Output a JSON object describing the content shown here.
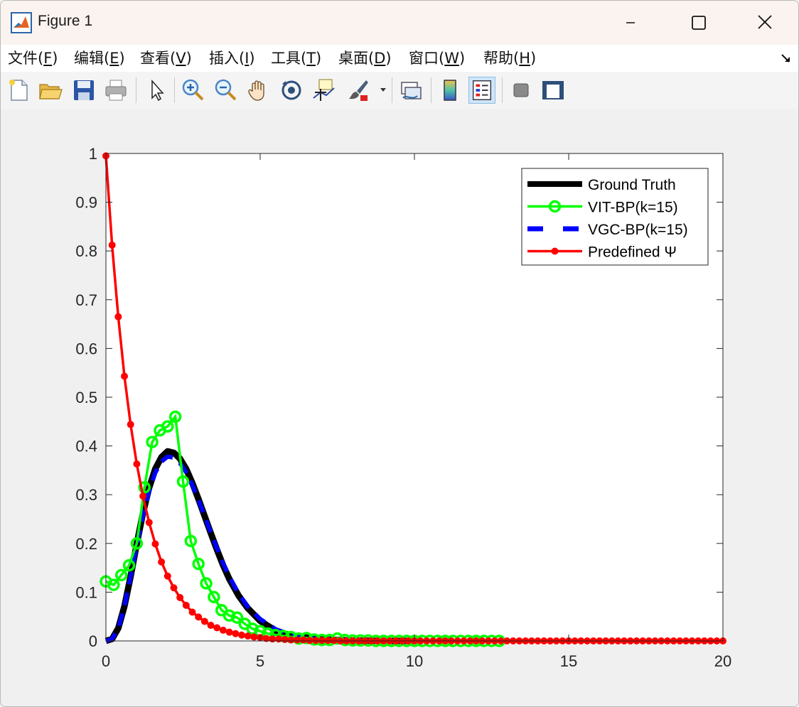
{
  "window": {
    "title": "Figure 1"
  },
  "menu": {
    "items": [
      {
        "label": "文件(",
        "key": "F",
        "tail": ")"
      },
      {
        "label": "编辑(",
        "key": "E",
        "tail": ")"
      },
      {
        "label": "查看(",
        "key": "V",
        "tail": ")"
      },
      {
        "label": "插入(",
        "key": "I",
        "tail": ")"
      },
      {
        "label": "工具(",
        "key": "T",
        "tail": ")"
      },
      {
        "label": "桌面(",
        "key": "D",
        "tail": ")"
      },
      {
        "label": "窗口(",
        "key": "W",
        "tail": ")"
      },
      {
        "label": "帮助(",
        "key": "H",
        "tail": ")"
      }
    ]
  },
  "toolbar": {
    "buttons": [
      "new-figure",
      "open-file",
      "save",
      "print",
      "edit-plot",
      "zoom-in",
      "zoom-out",
      "pan",
      "rotate-3d",
      "data-cursor",
      "brush",
      "link-plot",
      "insert-colorbar",
      "insert-legend",
      "hide-plot-tools",
      "show-plot-tools"
    ],
    "pressed": "insert-legend"
  },
  "chart_data": {
    "type": "line",
    "xlim": [
      0,
      20
    ],
    "ylim": [
      0,
      1
    ],
    "x_ticks": [
      0,
      5,
      10,
      15,
      20
    ],
    "y_ticks": [
      0,
      0.1,
      0.2,
      0.3,
      0.4,
      0.5,
      0.6,
      0.7,
      0.8,
      0.9,
      1
    ],
    "x_tick_labels": [
      "0",
      "5",
      "10",
      "15",
      "20"
    ],
    "y_tick_labels": [
      "0",
      "0.1",
      "0.2",
      "0.3",
      "0.4",
      "0.5",
      "0.6",
      "0.7",
      "0.8",
      "0.9",
      "1"
    ],
    "grid": false,
    "legend_position": "top-right",
    "series": [
      {
        "name": "Ground Truth",
        "color": "#000000",
        "style": "solid-thick",
        "x": [
          0,
          0.2,
          0.4,
          0.6,
          0.8,
          1.0,
          1.2,
          1.4,
          1.6,
          1.8,
          2.0,
          2.2,
          2.4,
          2.6,
          2.8,
          3.0,
          3.2,
          3.4,
          3.6,
          3.8,
          4.0,
          4.3,
          4.6,
          5.0,
          5.5,
          6.0,
          7.0,
          8.0,
          9.0,
          10.0
        ],
        "y": [
          0,
          0.004,
          0.026,
          0.071,
          0.132,
          0.199,
          0.262,
          0.314,
          0.353,
          0.377,
          0.389,
          0.386,
          0.374,
          0.353,
          0.324,
          0.291,
          0.256,
          0.221,
          0.187,
          0.155,
          0.127,
          0.093,
          0.067,
          0.041,
          0.021,
          0.011,
          0.003,
          0.001,
          0,
          0
        ]
      },
      {
        "name": "VGC-BP(k=15)",
        "color": "#0000ff",
        "style": "dashed-thick",
        "x": [
          0,
          0.2,
          0.4,
          0.6,
          0.8,
          1.0,
          1.2,
          1.4,
          1.6,
          1.8,
          2.0,
          2.2,
          2.4,
          2.6,
          2.8,
          3.0,
          3.2,
          3.4,
          3.6,
          3.8,
          4.0,
          4.3,
          4.6,
          5.0,
          5.5,
          6.0,
          7.0,
          8.0,
          9.0,
          10.0
        ],
        "y": [
          0,
          0.004,
          0.026,
          0.071,
          0.131,
          0.196,
          0.257,
          0.307,
          0.345,
          0.368,
          0.378,
          0.376,
          0.365,
          0.346,
          0.32,
          0.289,
          0.256,
          0.222,
          0.19,
          0.159,
          0.132,
          0.097,
          0.07,
          0.045,
          0.024,
          0.013,
          0.003,
          0.001,
          0,
          0
        ]
      },
      {
        "name": "VIT-BP(k=15)",
        "color": "#00ff00",
        "style": "line-circle-markers",
        "x": [
          0.0,
          0.25,
          0.5,
          0.75,
          1.0,
          1.25,
          1.5,
          1.75,
          2.0,
          2.25,
          2.5,
          2.75,
          3.0,
          3.25,
          3.5,
          3.75,
          4.0,
          4.25,
          4.5,
          4.75,
          5.0,
          5.25,
          5.5,
          5.75,
          6.0,
          6.25,
          6.5,
          6.75,
          7.0,
          7.25,
          7.5,
          7.75,
          8.0,
          8.25,
          8.5,
          8.75,
          9.0,
          9.25,
          9.5,
          9.75,
          10.0,
          10.25,
          10.5,
          10.75,
          11.0,
          11.25,
          11.5,
          11.75,
          12.0,
          12.25,
          12.5,
          12.75
        ],
        "y": [
          0.122,
          0.115,
          0.135,
          0.155,
          0.2,
          0.315,
          0.408,
          0.432,
          0.44,
          0.46,
          0.327,
          0.205,
          0.158,
          0.118,
          0.09,
          0.063,
          0.052,
          0.048,
          0.035,
          0.025,
          0.02,
          0.015,
          0.012,
          0.01,
          0.008,
          0.005,
          0.006,
          0.003,
          0.002,
          0.002,
          0.005,
          0.002,
          0.001,
          0.001,
          0.001,
          0.0,
          0.0,
          0.0,
          0.0,
          0.0,
          0.0,
          0.0,
          0.0,
          0.0,
          0.0,
          0.0,
          0.0,
          0.0,
          0.0,
          0.0,
          0.0,
          0.0
        ]
      },
      {
        "name": "Predefined Ψ",
        "color": "#ff0000",
        "style": "line-dot-markers",
        "x": [
          0.0,
          0.2,
          0.4,
          0.6,
          0.8,
          1.0,
          1.2,
          1.4,
          1.6,
          1.8,
          2.0,
          2.2,
          2.4,
          2.6,
          2.8,
          3.0,
          3.2,
          3.4,
          3.6,
          3.8,
          4.0,
          4.2,
          4.4,
          4.6,
          4.8,
          5.0,
          5.2,
          5.4,
          5.6,
          5.8,
          6.0,
          6.2,
          6.4,
          6.6,
          6.8,
          7.0,
          7.2,
          7.4,
          7.6,
          7.8,
          8.0,
          8.2,
          8.4,
          8.6,
          8.8,
          9.0,
          9.2,
          9.4,
          9.6,
          9.8,
          10.0,
          10.2,
          10.4,
          10.6,
          10.8,
          11.0,
          11.2,
          11.4,
          11.6,
          11.8,
          12.0,
          12.2,
          12.4,
          12.6,
          12.8,
          13.0,
          13.2,
          13.4,
          13.6,
          13.8,
          14.0,
          14.2,
          14.4,
          14.6,
          14.8,
          15.0,
          15.2,
          15.4,
          15.6,
          15.8,
          16.0,
          16.2,
          16.4,
          16.6,
          16.8,
          17.0,
          17.2,
          17.4,
          17.6,
          17.8,
          18.0,
          18.2,
          18.4,
          18.6,
          18.8,
          19.0,
          19.2,
          19.4,
          19.6,
          19.8,
          20.0
        ],
        "y": [
          0.995,
          0.812,
          0.665,
          0.543,
          0.444,
          0.363,
          0.297,
          0.243,
          0.199,
          0.162,
          0.133,
          0.109,
          0.089,
          0.073,
          0.059,
          0.049,
          0.04,
          0.032,
          0.027,
          0.022,
          0.018,
          0.015,
          0.012,
          0.01,
          0.008,
          0.007,
          0.005,
          0.004,
          0.004,
          0.003,
          0.002,
          0.002,
          0.002,
          0.001,
          0.001,
          0.001,
          0.001,
          0.001,
          0.0,
          0.0,
          0.0,
          0.0,
          0.0,
          0.0,
          0.0,
          0.0,
          0.0,
          0.0,
          0.0,
          0.0,
          0.0,
          0.0,
          0.0,
          0.0,
          0.0,
          0.0,
          0.0,
          0.0,
          0.0,
          0.0,
          0.0,
          0.0,
          0.0,
          0.0,
          0.0,
          0.0,
          0.0,
          0.0,
          0.0,
          0.0,
          0.0,
          0.0,
          0.0,
          0.0,
          0.0,
          0.0,
          0.0,
          0.0,
          0.0,
          0.0,
          0.0,
          0.0,
          0.0,
          0.0,
          0.0,
          0.0,
          0.0,
          0.0,
          0.0,
          0.0,
          0.0,
          0.0,
          0.0,
          0.0,
          0.0,
          0.0,
          0.0,
          0.0,
          0.0,
          0.0,
          0.0
        ]
      }
    ],
    "legend_order": [
      "Ground Truth",
      "VIT-BP(k=15)",
      "VGC-BP(k=15)",
      "Predefined Ψ"
    ]
  }
}
